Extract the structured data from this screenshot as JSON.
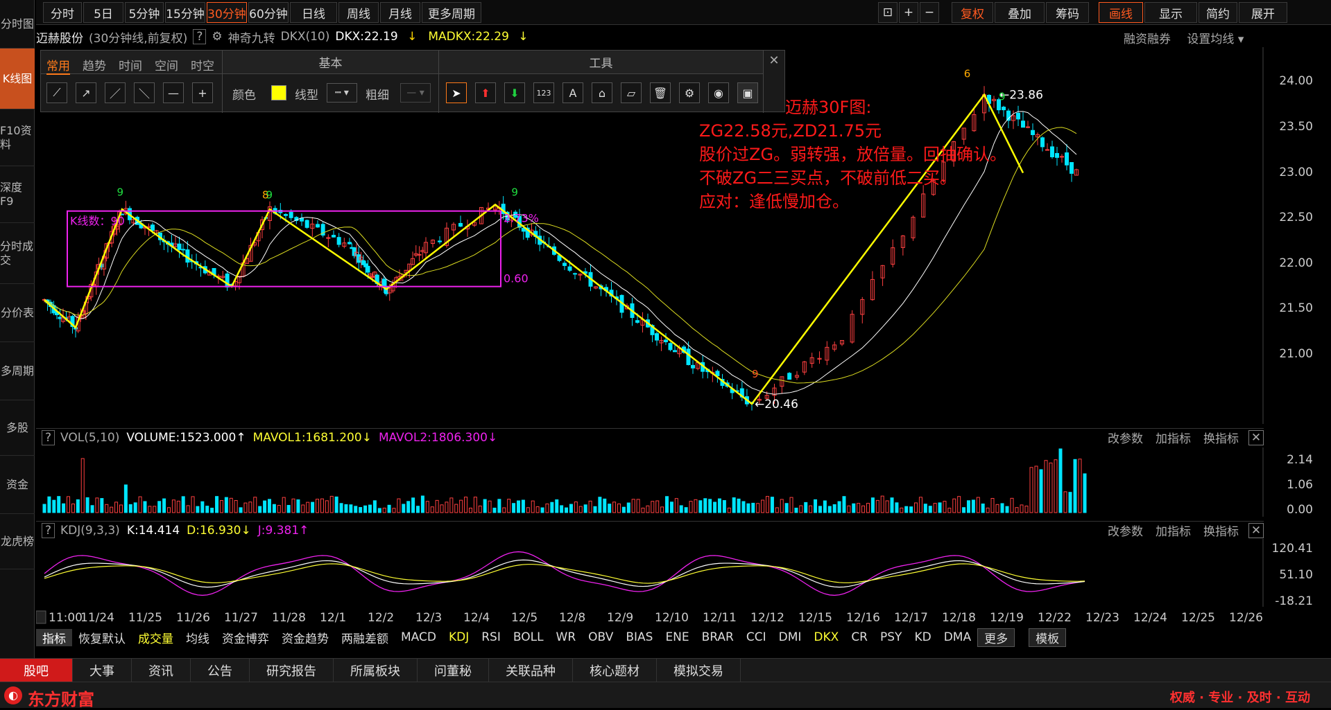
{
  "leftnav": [
    "分时图",
    "K线图",
    "F10资料",
    "深度F9",
    "分时成交",
    "分价表",
    "多周期",
    "多股",
    "资金",
    "龙虎榜"
  ],
  "leftnav_active": 1,
  "toolbar": {
    "periods": [
      "分时",
      "5日",
      "5分钟",
      "15分钟",
      "30分钟",
      "60分钟",
      "日线",
      "周线",
      "月线",
      "更多周期"
    ],
    "active": "30分钟",
    "right": [
      "复权",
      "叠加",
      "筹码",
      "画线",
      "显示",
      "简约",
      "展开"
    ]
  },
  "title": {
    "name": "迈赫股份",
    "period": "(30分钟线,前复权)",
    "help": "?",
    "indicator": "神奇九转",
    "dkx_name": "DKX(10)",
    "dkx": "DKX:22.19",
    "madkx": "MADKX:22.29",
    "links": [
      "融资融券",
      "设置均线"
    ]
  },
  "drawtools": {
    "tabs": [
      "常用",
      "趋势",
      "时间",
      "空间",
      "时空"
    ],
    "basic": "基本",
    "tool": "工具",
    "color_label": "颜色",
    "style_label": "线型",
    "width_label": "粗细",
    "color": "#ffff00"
  },
  "annotation": [
    "迈赫30F图:",
    "ZG22.58元,ZD21.75元",
    "股价过ZG。弱转强，放倍量。回抽确认。",
    "不破ZG二三买点，不破前低二买。",
    "应对：逢低慢加仓。"
  ],
  "chart_data": {
    "type": "candlestick",
    "ylim": [
      20.3,
      24.2
    ],
    "yticks": [
      "24.00",
      "23.50",
      "23.00",
      "22.50",
      "22.00",
      "21.50",
      "21.00"
    ],
    "high_label": "23.86",
    "low_label": "20.46",
    "box_labels": [
      "K线数：90",
      "2.73%",
      "0.60"
    ],
    "dates": [
      "11:00",
      "11/24",
      "11/25",
      "11/26",
      "11/27",
      "11/28",
      "12/1",
      "12/2",
      "12/3",
      "12/4",
      "12/5",
      "12/8",
      "12/9",
      "12/10",
      "12/11",
      "12/12",
      "12/15",
      "12/16",
      "12/17",
      "12/18",
      "12/19",
      "12/22",
      "12/23",
      "12/24",
      "12/25",
      "12/26"
    ]
  },
  "vol": {
    "label": "VOL(5,10)",
    "volume": "VOLUME:1523.000",
    "mavol1": "MAVOL1:1681.200",
    "mavol2": "MAVOL2:1806.300",
    "yticks": [
      "2.14",
      "1.06",
      "0.00"
    ],
    "links": [
      "改参数",
      "加指标",
      "换指标"
    ]
  },
  "kdj": {
    "label": "KDJ(9,3,3)",
    "k": "K:14.414",
    "d": "D:16.930",
    "j": "J:9.381",
    "yticks": [
      "120.41",
      "51.10",
      "-18.21"
    ],
    "links": [
      "改参数",
      "加指标",
      "换指标"
    ]
  },
  "bottomtabs": [
    "指标",
    "恢复默认",
    "成交量",
    "均线",
    "资金博弈",
    "资金趋势",
    "两融差额",
    "MACD",
    "KDJ",
    "RSI",
    "BOLL",
    "WR",
    "OBV",
    "BIAS",
    "ENE",
    "BRAR",
    "CCI",
    "DMI",
    "DKX",
    "CR",
    "PSY",
    "KD",
    "DMA",
    "更多",
    "模板"
  ],
  "footer": [
    "股吧",
    "大事",
    "资讯",
    "公告",
    "研究报告",
    "所属板块",
    "问董秘",
    "关联品种",
    "核心题材",
    "模拟交易"
  ],
  "brand": {
    "name": "东方财富",
    "slogan": "权威 · 专业 · 及时 · 互动"
  },
  "colors": {
    "up": "#ff4040",
    "down": "#00e5ff",
    "accent": "#ff5a20",
    "yellow": "#ffff33",
    "magenta": "#ee22ee"
  }
}
